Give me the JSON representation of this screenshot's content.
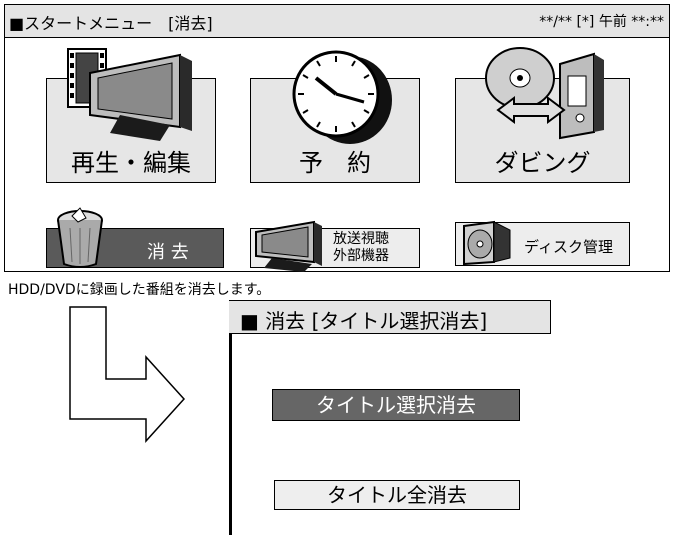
{
  "header": {
    "title": "■スタートメニュー　[消去]",
    "clock": "**/** [*] 午前 **:**"
  },
  "tiles": [
    {
      "label": "再生・編集",
      "icon": "film-tv-icon"
    },
    {
      "label": "予　約",
      "icon": "clock-icon"
    },
    {
      "label": "ダビング",
      "icon": "disc-transfer-icon"
    }
  ],
  "small_buttons": [
    {
      "label": "消 去",
      "icon": "trash-icon",
      "selected": true
    },
    {
      "line1": "放送視聴",
      "line2": "外部機器",
      "icon": "tv-icon"
    },
    {
      "label": "ディスク管理",
      "icon": "disc-case-icon"
    }
  ],
  "description": "HDD/DVDに録画した番組を消去します。",
  "arrow": {
    "icon": "arrow-down-right-icon"
  },
  "submenu": {
    "title": "■ 消去 [タイトル選択消去]",
    "items": [
      {
        "label": "タイトル選択消去",
        "selected": true
      },
      {
        "label": "タイトル全消去",
        "selected": false
      }
    ]
  },
  "colors": {
    "selected": "#5a5a5a",
    "tile": "#e6e6e6",
    "header": "#e4e4e4"
  }
}
